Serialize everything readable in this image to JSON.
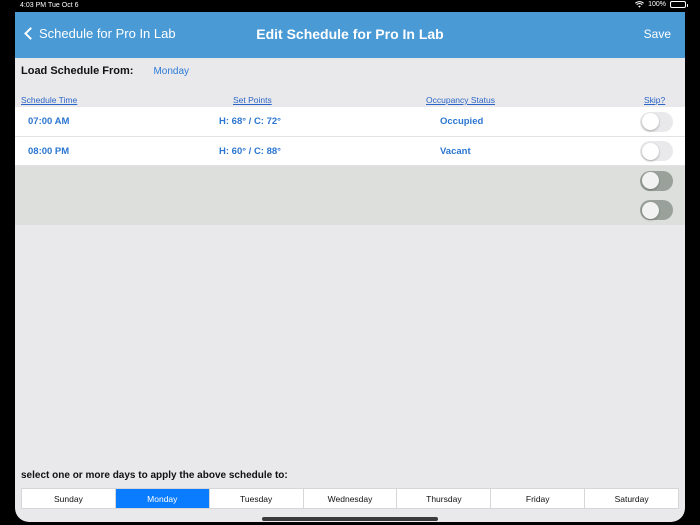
{
  "status": {
    "time": "4:03 PM",
    "date": "Tue Oct 6",
    "battery": "100%",
    "battery_level": 1.0
  },
  "nav": {
    "back_label": "Schedule for Pro In Lab",
    "title": "Edit Schedule for Pro In Lab",
    "save_label": "Save"
  },
  "load": {
    "label": "Load Schedule From:",
    "value": "Monday"
  },
  "columns": {
    "time": "Schedule Time",
    "set_points": "Set Points",
    "occupancy": "Occupancy Status",
    "skip": "Skip?"
  },
  "rows": [
    {
      "time": "07:00 AM",
      "set_points": "H: 68° / C: 72°",
      "occupancy": "Occupied",
      "skip": false
    },
    {
      "time": "08:00 PM",
      "set_points": "H: 60° / C: 88°",
      "occupancy": "Vacant",
      "skip": false
    }
  ],
  "empty_rows": 2,
  "apply_label": "select one or more days to apply the above schedule to:",
  "days": [
    {
      "label": "Sunday",
      "selected": false
    },
    {
      "label": "Monday",
      "selected": true
    },
    {
      "label": "Tuesday",
      "selected": false
    },
    {
      "label": "Wednesday",
      "selected": false
    },
    {
      "label": "Thursday",
      "selected": false
    },
    {
      "label": "Friday",
      "selected": false
    },
    {
      "label": "Saturday",
      "selected": false
    }
  ],
  "colors": {
    "nav_bar": "#4a9ad6",
    "accent": "#2b76d0",
    "selected_day": "#0a7cff",
    "background": "#e9e8ea"
  }
}
